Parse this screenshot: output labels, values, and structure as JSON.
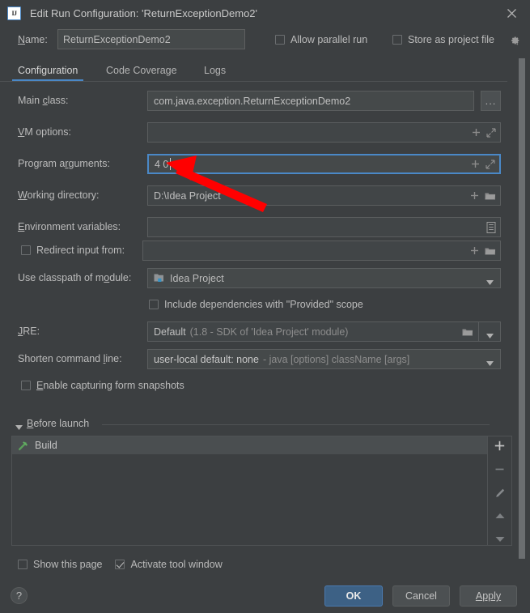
{
  "window": {
    "title": "Edit Run Configuration: 'ReturnExceptionDemo2'",
    "logo_text": "IJ",
    "close_icon": "close-icon"
  },
  "name_row": {
    "label": "Name:",
    "value": "ReturnExceptionDemo2",
    "allow_parallel_run": {
      "label": "Allow parallel run",
      "checked": false
    },
    "store_as_project_file": {
      "label": "Store as project file",
      "checked": false
    },
    "gear_icon": "gear-icon"
  },
  "tabs": [
    {
      "label": "Configuration",
      "active": true
    },
    {
      "label": "Code Coverage",
      "active": false
    },
    {
      "label": "Logs",
      "active": false
    }
  ],
  "fields": {
    "main_class": {
      "label": "Main class:",
      "value": "com.java.exception.ReturnExceptionDemo2",
      "browse_label": "..."
    },
    "vm_options": {
      "label": "VM options:",
      "value": "",
      "icons": [
        "plus-icon",
        "expand-icon"
      ]
    },
    "program_arguments": {
      "label": "Program arguments:",
      "value": "4 0",
      "focused": true,
      "icons": [
        "plus-icon",
        "expand-icon"
      ]
    },
    "working_directory": {
      "label": "Working directory:",
      "value": "D:\\Idea Project",
      "icons": [
        "plus-icon",
        "folder-icon"
      ]
    },
    "environment_variables": {
      "label": "Environment variables:",
      "value": "",
      "icons": [
        "list-icon"
      ]
    },
    "redirect_input_from": {
      "label": "Redirect input from:",
      "checked": false,
      "value": "",
      "icons": [
        "plus-icon",
        "folder-icon"
      ]
    },
    "use_classpath_of_module": {
      "label": "Use classpath of module:",
      "value": "Idea Project",
      "module_icon": "module-icon"
    },
    "include_provided_scope": {
      "label": "Include dependencies with \"Provided\" scope",
      "checked": false
    },
    "jre": {
      "label": "JRE:",
      "value": "Default",
      "value_hint": "(1.8 - SDK of 'Idea Project' module)",
      "icons": [
        "folder-icon",
        "chevron-down-icon"
      ]
    },
    "shorten_command_line": {
      "label": "Shorten command line:",
      "value": "user-local default: none",
      "value_hint": "- java [options] className [args]"
    },
    "enable_form_snapshots": {
      "label": "Enable capturing form snapshots",
      "checked": false
    }
  },
  "before_launch": {
    "title": "Before launch",
    "collapse_icon": "triangle-down-icon",
    "items": [
      {
        "label": "Build",
        "icon": "build-hammer-icon"
      }
    ],
    "toolbar": [
      {
        "name": "add-button",
        "glyph": "+"
      },
      {
        "name": "remove-button",
        "glyph": "−"
      },
      {
        "name": "edit-button",
        "glyph": "pencil-icon"
      },
      {
        "name": "move-up-button",
        "glyph": "triangle-up-icon"
      },
      {
        "name": "move-down-button",
        "glyph": "triangle-down-icon"
      }
    ]
  },
  "bottom": {
    "show_this_page": {
      "label": "Show this page",
      "checked": false
    },
    "activate_tool_window": {
      "label": "Activate tool window",
      "checked": true
    },
    "help_label": "?",
    "ok_label": "OK",
    "cancel_label": "Cancel",
    "apply_label": "Apply"
  },
  "annotation": {
    "type": "red-arrow",
    "color": "#ff0000"
  },
  "colors": {
    "background": "#3c3f41",
    "field_background": "#45494a",
    "accent_blue": "#4a88c7",
    "primary_button": "#3d6185",
    "text": "#bbbbbb"
  }
}
